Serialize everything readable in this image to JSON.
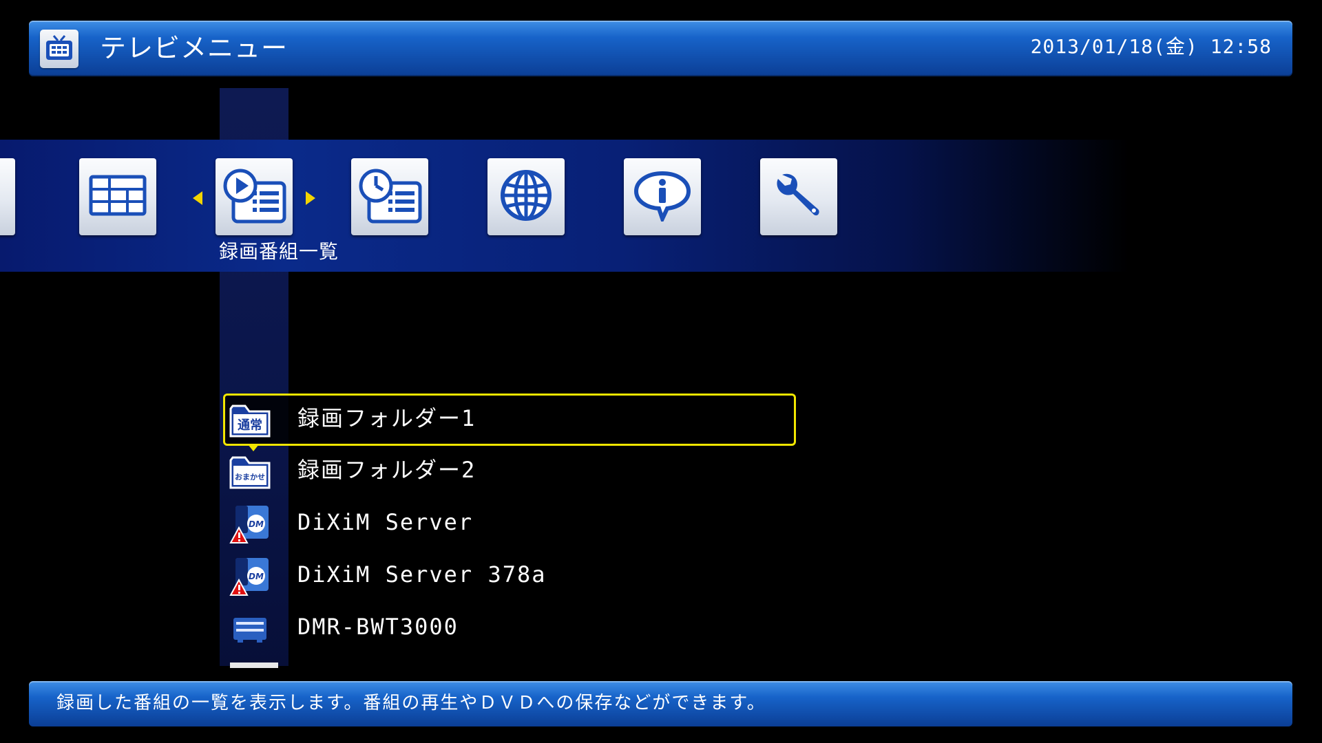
{
  "header": {
    "title": "テレビメニュー",
    "datetime": "2013/01/18(金) 12:58",
    "icon": "tv-icon"
  },
  "menu": {
    "selected_label": "録画番組一覧",
    "tiles": [
      {
        "icon": "partial-tile-icon"
      },
      {
        "icon": "program-guide-icon"
      },
      {
        "icon": "recorded-list-icon"
      },
      {
        "icon": "timer-recording-icon"
      },
      {
        "icon": "internet-globe-icon"
      },
      {
        "icon": "info-icon"
      },
      {
        "icon": "settings-wrench-icon"
      }
    ]
  },
  "list": {
    "items": [
      {
        "label": "録画フォルダー1",
        "icon": "folder-normal-icon",
        "icon_text": "通常"
      },
      {
        "label": "録画フォルダー2",
        "icon": "folder-omakase-icon",
        "icon_text": "おまかせ"
      },
      {
        "label": "DiXiM Server",
        "icon": "dixim-server-warning-icon",
        "icon_text": "DM"
      },
      {
        "label": "DiXiM Server 378a",
        "icon": "dixim-server-warning-icon",
        "icon_text": "DM"
      },
      {
        "label": "DMR-BWT3000",
        "icon": "recorder-device-icon"
      }
    ]
  },
  "footer": {
    "text": "録画した番組の一覧を表示します。番組の再生やＤＶＤへの保存などができます。"
  },
  "colors": {
    "selection": "#f2e600",
    "header_blue": "#1763c9",
    "band_blue": "#0a2a8a",
    "icon_blue": "#1a4fb8"
  }
}
